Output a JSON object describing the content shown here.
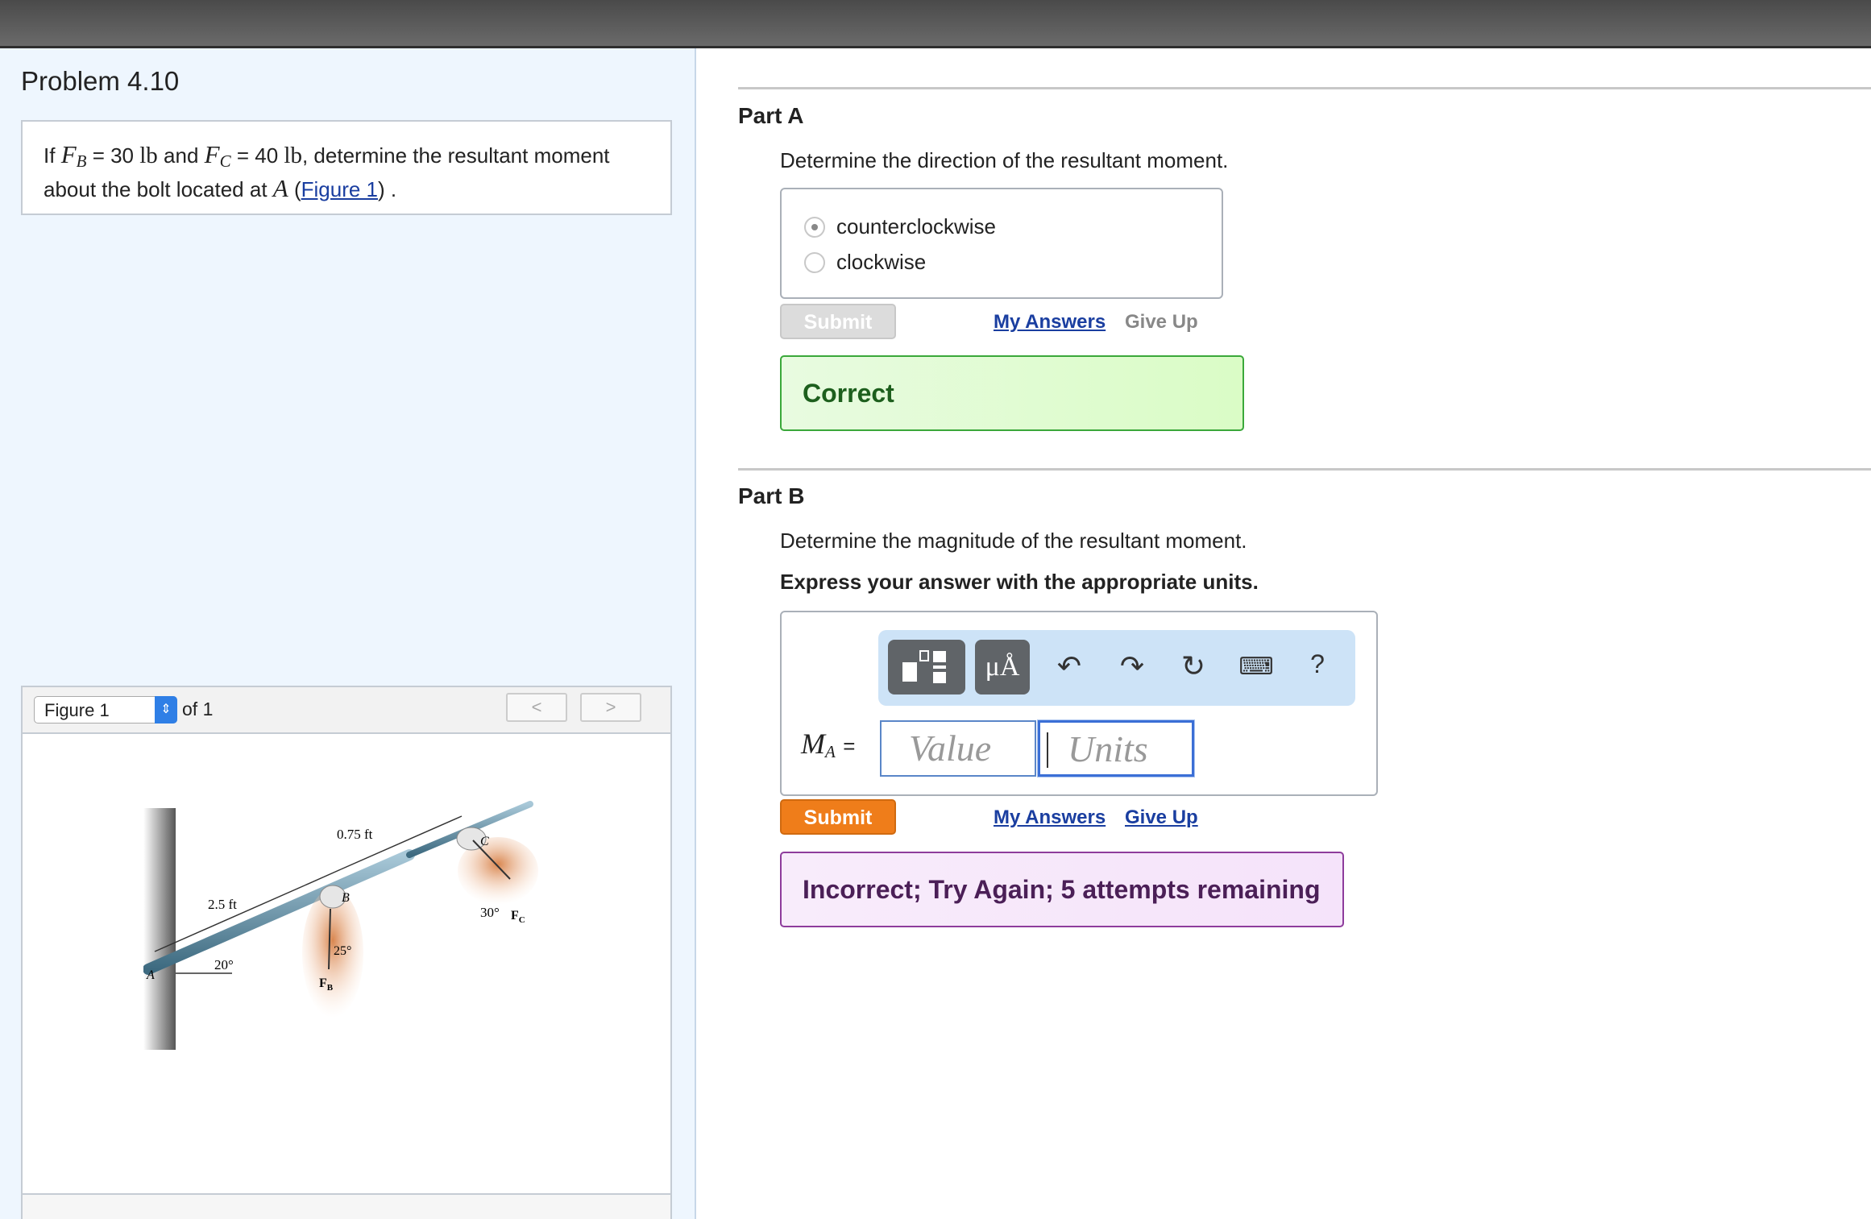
{
  "problem": {
    "title": "Problem 4.10",
    "text_if": "If",
    "fb_label": "F",
    "fb_sub": "B",
    "fb_value": "= 30",
    "unit_lb": "lb",
    "and": "and",
    "fc_label": "F",
    "fc_sub": "C",
    "fc_value": "= 40",
    "text_after": ", determine the resultant moment",
    "text_line2": "about the bolt located at",
    "point": "A",
    "figure_link": "Figure 1",
    "paren_open": "(",
    "paren_close": ") ."
  },
  "figure": {
    "select_value": "Figure 1",
    "of_label": "of 1",
    "prev": "<",
    "next": ">",
    "labels": {
      "d075": "0.75 ft",
      "d25": "2.5 ft",
      "a20": "20°",
      "a25": "25°",
      "a30": "30°",
      "fb": "F",
      "fb_sub": "B",
      "fc": "F",
      "fc_sub": "C",
      "pa": "A",
      "pb": "B",
      "pc": "C"
    }
  },
  "partA": {
    "heading": "Part A",
    "question": "Determine the direction of the resultant moment.",
    "options": [
      "counterclockwise",
      "clockwise"
    ],
    "selected": "counterclockwise",
    "submit": "Submit",
    "my_answers": "My Answers",
    "give_up": "Give Up",
    "feedback": "Correct"
  },
  "partB": {
    "heading": "Part B",
    "question": "Determine the magnitude of the resultant moment.",
    "instruction": "Express your answer with the appropriate units.",
    "toolbar": {
      "units_btn": "μÅ",
      "help": "?"
    },
    "var_label": "M",
    "var_sub": "A",
    "equals": "=",
    "value_placeholder": "Value",
    "units_placeholder": "Units",
    "submit": "Submit",
    "my_answers": "My Answers",
    "give_up": "Give Up",
    "feedback": "Incorrect; Try Again; 5 attempts remaining"
  }
}
